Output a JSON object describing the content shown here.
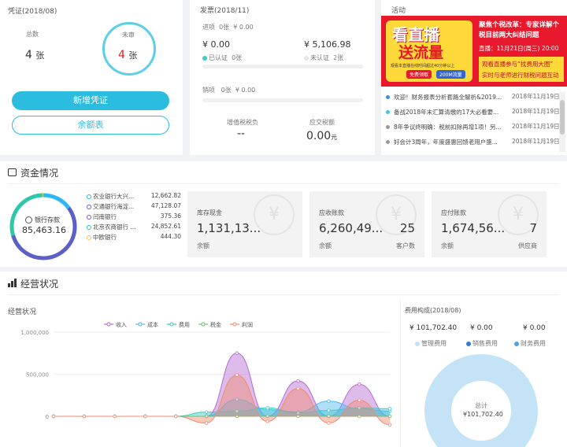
{
  "voucher": {
    "title": "凭证(2018/08)",
    "total_label": "总数",
    "total_value": "4",
    "unit": "张",
    "unreviewed_label": "未审",
    "unreviewed_value": "4",
    "add_button": "新增凭证",
    "balance_button": "余额表"
  },
  "invoice": {
    "title": "发票(2018/11)",
    "input_label": "进项",
    "input_count": "0张",
    "input_amount": "¥ 0.00",
    "left_amount": "¥ 0.00",
    "left_status": "已认证",
    "left_count": "0张",
    "right_amount": "¥ 5,106.98",
    "right_status": "未认证",
    "right_count": "2张",
    "output_label": "销项",
    "output_count": "0张",
    "output_amount": "¥ 0.00",
    "vat_label": "增值税税负",
    "vat_value": "--",
    "tax_label": "应交税额",
    "tax_value": "0.00",
    "tax_unit": "元"
  },
  "activity": {
    "title": "活动",
    "banner": {
      "big1": "看直播",
      "big2": "送流量",
      "right_title": "聚焦个税改革：专家详解个税目前两大纠结问题",
      "right_time": "直播：11月21日(周三) 20:00",
      "right_sub1": "观看直播参与“找费用大圈”",
      "right_sub2": "实时与老师进行财税问题互动",
      "small_text": "观看本直播在线时间超过40分钟以上",
      "btn1": "免费领取",
      "btn2": "200M流量"
    },
    "items": [
      {
        "text": "欢迎！财务报表分析套路全解析&2019...",
        "date": "2018年11月19日",
        "color": "#3a8ee6"
      },
      {
        "text": "备战2018年末汇算清缴的17大必看要...",
        "date": "2018年11月19日",
        "color": "#42c6e8"
      },
      {
        "text": "8年争议终明确：税前扣除再增1项！另...",
        "date": "2018年11月19日",
        "color": "#999999"
      },
      {
        "text": "好会计3周年，年度盛惠回馈老用户盛...",
        "date": "2018年11月19日",
        "color": "#999999"
      }
    ]
  },
  "funds": {
    "title": "资金情况",
    "donut_label": "银行存款",
    "donut_value": "85,463.16",
    "banks": [
      {
        "name": "农业银行大兴...",
        "amount": "12,662.82",
        "color": "#2db7f5"
      },
      {
        "name": "交通银行海淀...",
        "amount": "47,128.07",
        "color": "#5b5fc7"
      },
      {
        "name": "闫南银行",
        "amount": "375.36",
        "color": "#7c4dcf"
      },
      {
        "name": "北京农商银行 ...",
        "amount": "24,852.61",
        "color": "#2ec7a8"
      },
      {
        "name": "中欧银行",
        "amount": "444.30",
        "color": "#f2c94c"
      }
    ],
    "tiles": [
      {
        "title": "库存现金",
        "value": "1,131,13...",
        "count": "",
        "bl": "余额",
        "br": "",
        "icon": "¥"
      },
      {
        "title": "应收账款",
        "value": "6,260,49...",
        "count": "25",
        "bl": "余额",
        "br": "客户数",
        "icon": "¥"
      },
      {
        "title": "应付账款",
        "value": "1,674,56...",
        "count": "7",
        "bl": "余额",
        "br": "供应商",
        "icon": "¥"
      }
    ]
  },
  "ops": {
    "title": "经营状况",
    "chart_title": "经营状况",
    "legend": [
      "收入",
      "成本",
      "费用",
      "税金",
      "利润"
    ],
    "yticks": [
      "1,000,000",
      "500,000",
      "0"
    ],
    "colors": {
      "收入": "#b36bd4",
      "成本": "#4fb8f2",
      "费用": "#40c9c9",
      "税金": "#6cc46c",
      "利润": "#f08a6e"
    }
  },
  "chart_data": {
    "type": "area",
    "title": "经营状况",
    "ylim": [
      0,
      1000000
    ],
    "x": [
      1,
      2,
      3,
      4,
      5,
      6,
      7,
      8,
      9,
      10,
      11,
      12
    ],
    "series": [
      {
        "name": "收入",
        "values": [
          0,
          0,
          0,
          0,
          0,
          0,
          750000,
          0,
          420000,
          0,
          380000,
          0
        ]
      },
      {
        "name": "成本",
        "values": [
          0,
          0,
          0,
          0,
          0,
          0,
          200000,
          80000,
          50000,
          180000,
          90000,
          60000
        ]
      },
      {
        "name": "费用",
        "values": [
          0,
          0,
          0,
          0,
          0,
          50000,
          60000,
          100000,
          40000,
          70000,
          100000,
          90000
        ]
      },
      {
        "name": "税金",
        "values": [
          0,
          0,
          0,
          0,
          0,
          0,
          0,
          0,
          0,
          0,
          0,
          0
        ]
      },
      {
        "name": "利润",
        "values": [
          0,
          0,
          0,
          0,
          0,
          -80000,
          490000,
          -60000,
          330000,
          -80000,
          190000,
          -100000
        ]
      }
    ]
  },
  "expense": {
    "title": "费用构成(2018/08)",
    "values": [
      "¥ 101,702.40",
      "¥ 0.00",
      "¥ 0.00"
    ],
    "labels": [
      "管理费用",
      "销售费用",
      "财务费用"
    ],
    "colors": [
      "#c5e3f6",
      "#2f7bd6",
      "#4aa3e8"
    ],
    "center_label": "总计",
    "center_value": "¥101,702.40"
  }
}
